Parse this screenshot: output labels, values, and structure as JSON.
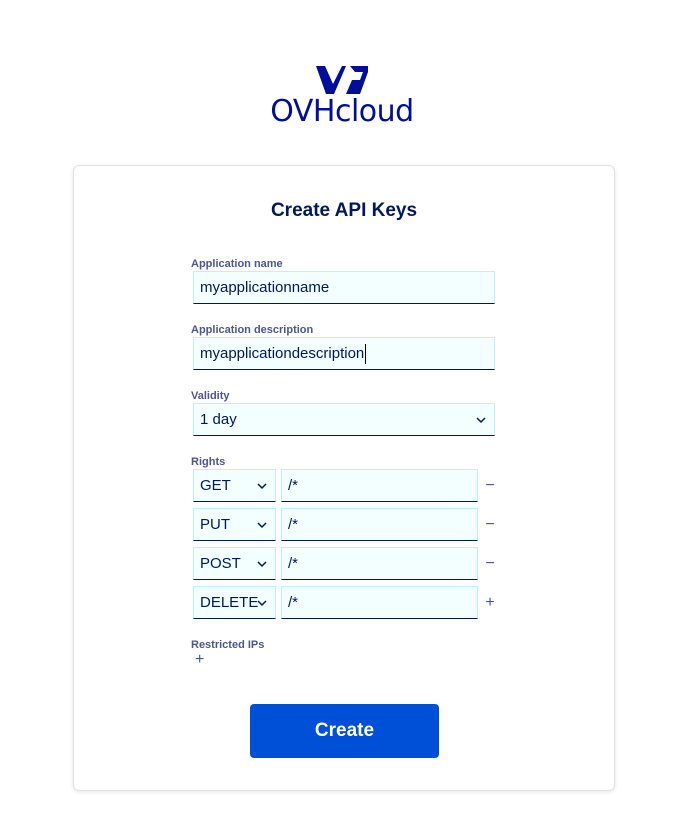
{
  "brand": {
    "name": "OVHcloud",
    "logo_icon": "ovhcloud-logo-icon",
    "color": "#000e9c"
  },
  "form": {
    "title": "Create API Keys",
    "application_name": {
      "label": "Application name",
      "value": "myapplicationname"
    },
    "application_description": {
      "label": "Application description",
      "value": "myapplicationdescription"
    },
    "validity": {
      "label": "Validity",
      "value": "1 day"
    },
    "rights": {
      "label": "Rights",
      "rows": [
        {
          "method": "GET",
          "path": "/*",
          "action": "−",
          "action_icon": "minus-icon"
        },
        {
          "method": "PUT",
          "path": "/*",
          "action": "−",
          "action_icon": "minus-icon"
        },
        {
          "method": "POST",
          "path": "/*",
          "action": "−",
          "action_icon": "minus-icon"
        },
        {
          "method": "DELETE",
          "path": "/*",
          "action": "+",
          "action_icon": "plus-icon"
        }
      ]
    },
    "restricted_ips": {
      "label": "Restricted IPs",
      "add": "+"
    },
    "submit_label": "Create"
  },
  "colors": {
    "primary_button": "#0050d7",
    "field_bg": "#f2feff",
    "field_border": "#bef1ff",
    "title_text": "#00185e",
    "label_text": "#4d5592"
  }
}
